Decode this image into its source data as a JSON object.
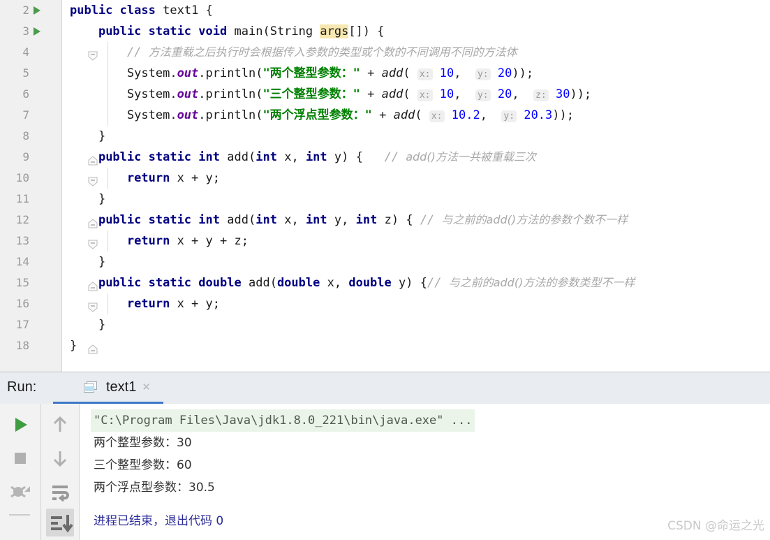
{
  "editor": {
    "name": "code-editor",
    "first_line_number": 2,
    "lines": [
      {
        "n": 2,
        "run_marker": true,
        "fold": "none",
        "indent": 0
      },
      {
        "n": 3,
        "run_marker": true,
        "fold": "open",
        "indent": 1
      },
      {
        "n": 4,
        "run_marker": false,
        "fold": "none",
        "indent": 2
      },
      {
        "n": 5,
        "run_marker": false,
        "fold": "none",
        "indent": 2
      },
      {
        "n": 6,
        "run_marker": false,
        "fold": "none",
        "indent": 2
      },
      {
        "n": 7,
        "run_marker": false,
        "fold": "none",
        "indent": 2
      },
      {
        "n": 8,
        "run_marker": false,
        "fold": "close",
        "indent": 1
      },
      {
        "n": 9,
        "run_marker": false,
        "fold": "open",
        "indent": 1
      },
      {
        "n": 10,
        "run_marker": false,
        "fold": "none",
        "indent": 2
      },
      {
        "n": 11,
        "run_marker": false,
        "fold": "close",
        "indent": 1
      },
      {
        "n": 12,
        "run_marker": false,
        "fold": "open",
        "indent": 1
      },
      {
        "n": 13,
        "run_marker": false,
        "fold": "none",
        "indent": 2
      },
      {
        "n": 14,
        "run_marker": false,
        "fold": "close",
        "indent": 1
      },
      {
        "n": 15,
        "run_marker": false,
        "fold": "open",
        "indent": 1
      },
      {
        "n": 16,
        "run_marker": false,
        "fold": "none",
        "indent": 2
      },
      {
        "n": 17,
        "run_marker": false,
        "fold": "close",
        "indent": 1
      },
      {
        "n": 18,
        "run_marker": false,
        "fold": "none",
        "indent": 0
      }
    ],
    "code_text": {
      "l2": "public class text1 {",
      "l3": "public static void main(String args[]) {",
      "l4": "// 方法重载之后执行时会根据传入参数的类型或个数的不同调用不同的方法体",
      "l5": "System.out.println(\"两个整型参数：\" + add( x: 10,  y: 20));",
      "l6": "System.out.println(\"三个整型参数：\" + add( x: 10,  y: 20,  z: 30));",
      "l7": "System.out.println(\"两个浮点型参数：\" + add( x: 10.2,  y: 20.3));",
      "l8": "}",
      "l9": "public static int add(int x, int y) {   // add()方法一共被重载三次",
      "l10": "return x + y;",
      "l11": "}",
      "l12": "public static int add(int x, int y, int z) { // 与之前的add()方法的参数个数不一样",
      "l13": "return x + y + z;",
      "l14": "}",
      "l15": "public static double add(double x, double y) {// 与之前的add()方法的参数类型不一样",
      "l16": "return x + y;",
      "l17": "}",
      "l18": "}"
    },
    "tokens": {
      "kw_public": "public",
      "kw_class": "class",
      "kw_static": "static",
      "kw_void": "void",
      "kw_int": "int",
      "kw_double": "double",
      "kw_return": "return",
      "type_string": "String",
      "class_name": "text1",
      "method_main": "main",
      "method_add": "add",
      "ident_args": "args",
      "ident_system": "System",
      "field_out": "out",
      "method_println": "println",
      "var_x": "x",
      "var_y": "y",
      "var_z": "z",
      "str_two_int": "\"两个整型参数：\"",
      "str_three_int": "\"三个整型参数：\"",
      "str_two_double": "\"两个浮点型参数：\"",
      "num_10": "10",
      "num_20": "20",
      "num_30": "30",
      "num_102": "10.2",
      "num_203": "20.3",
      "hint_x": "x:",
      "hint_y": "y:",
      "hint_z": "z:",
      "comment_line4": "方法重载之后执行时会根据传入参数的类型或个数的不同调用不同的方法体",
      "comment_line9": "add()方法一共被重载三次",
      "comment_line12": "与之前的add()方法的参数个数不一样",
      "comment_line15": "与之前的add()方法的参数类型不一样",
      "slashes": "//"
    },
    "colors": {
      "keyword": "#000080",
      "string": "#008000",
      "number": "#0000ff",
      "comment": "#a8a8a8",
      "field": "#660099",
      "gutter_bg": "#f0f0f0",
      "line_number": "#999999",
      "caret_highlight": "#f7e7b0",
      "hint_bg": "#efefef"
    }
  },
  "run_panel": {
    "label": "Run:",
    "tab": {
      "title": "text1",
      "close_label": "×",
      "icon": "run-configuration-icon",
      "active": true,
      "underline_color": "#3c78c8"
    },
    "toolbar_left": [
      {
        "name": "rerun-button",
        "icon": "play-icon"
      },
      {
        "name": "stop-button",
        "icon": "stop-square-icon"
      },
      {
        "name": "rerun-failed-tests-button",
        "icon": "bug-rerun-icon"
      }
    ],
    "toolbar_right": [
      {
        "name": "up-stack-trace-button",
        "icon": "arrow-up-icon"
      },
      {
        "name": "down-stack-trace-button",
        "icon": "arrow-down-icon"
      },
      {
        "name": "soft-wrap-button",
        "icon": "soft-wrap-icon"
      },
      {
        "name": "scroll-to-end-button",
        "icon": "scroll-to-end-icon",
        "selected": true
      }
    ],
    "console": {
      "command_line": "\"C:\\Program Files\\Java\\jdk1.8.0_221\\bin\\java.exe\" ...",
      "output_lines": [
        "两个整型参数：30",
        "三个整型参数：60",
        "两个浮点型参数：30.5"
      ],
      "exit_line": "进程已结束，退出代码 0"
    }
  },
  "watermark": {
    "text": "CSDN @命运之光"
  }
}
